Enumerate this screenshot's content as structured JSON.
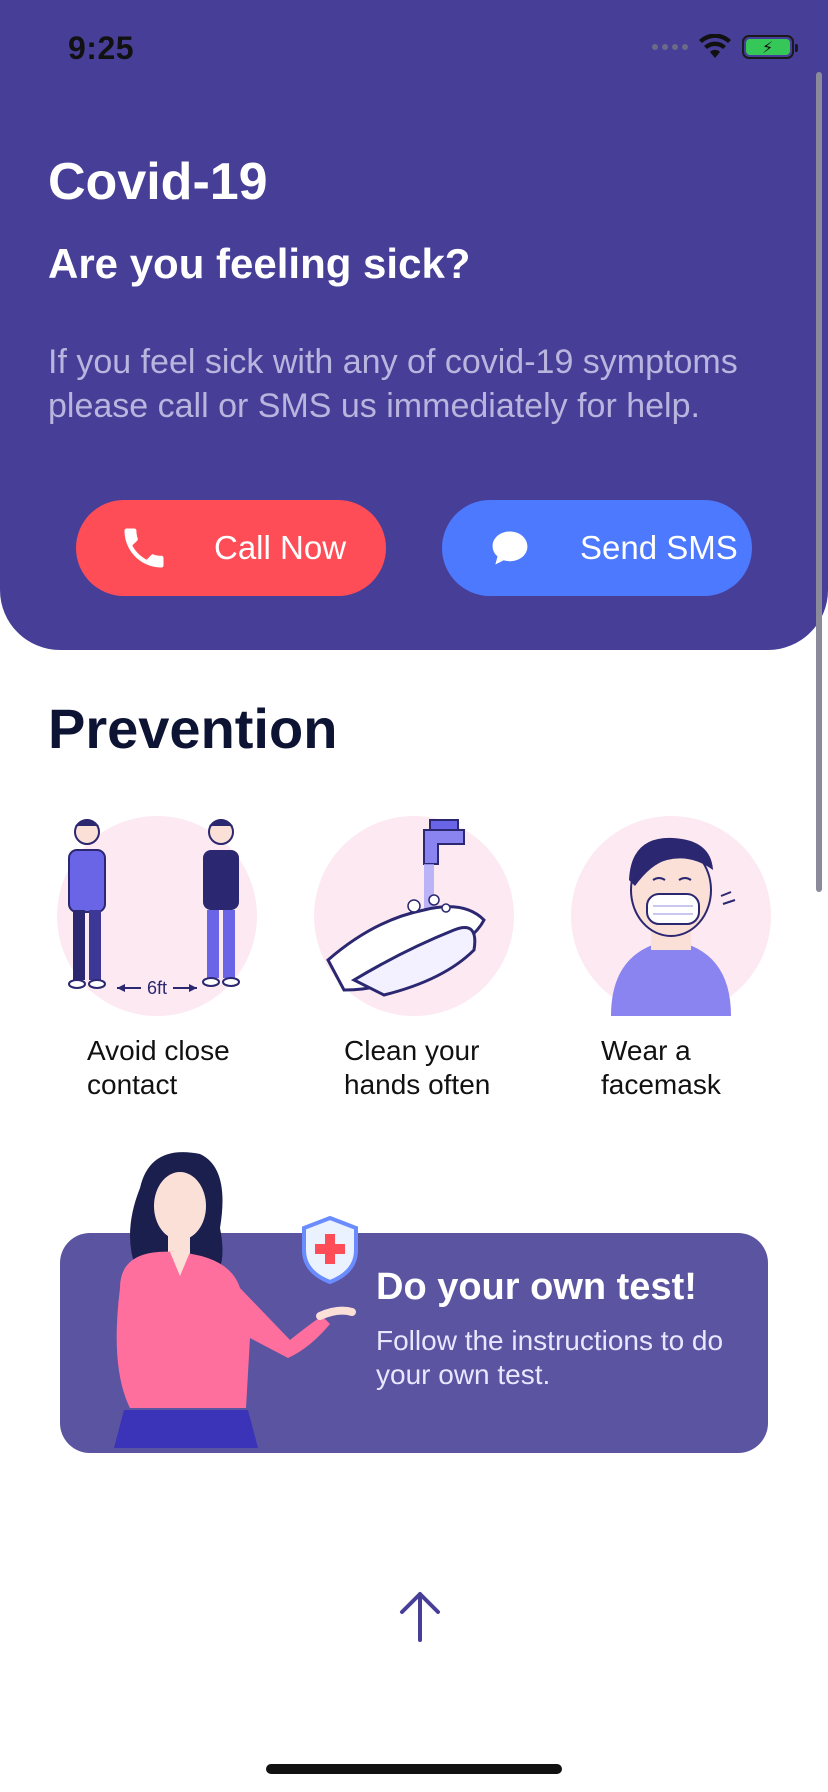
{
  "status_bar": {
    "time": "9:25"
  },
  "header": {
    "title": "Covid-19",
    "subtitle": "Are you feeling sick?",
    "description": "If you feel sick with any of covid-19 symptoms please call or SMS us immediately for help.",
    "call_button": "Call Now",
    "sms_button": "Send SMS"
  },
  "prevention": {
    "title": "Prevention",
    "items": [
      {
        "label": "Avoid close contact",
        "distance_label": "6ft"
      },
      {
        "label": "Clean your hands often"
      },
      {
        "label": "Wear a facemask"
      }
    ]
  },
  "test_card": {
    "title": "Do your own test!",
    "description": "Follow the instructions to do your own test."
  },
  "colors": {
    "header_bg": "#473F97",
    "call_button": "#FF4D58",
    "sms_button": "#4D79FF",
    "card_bg": "#5A54A1",
    "circle_bg": "#FDE9F2"
  }
}
